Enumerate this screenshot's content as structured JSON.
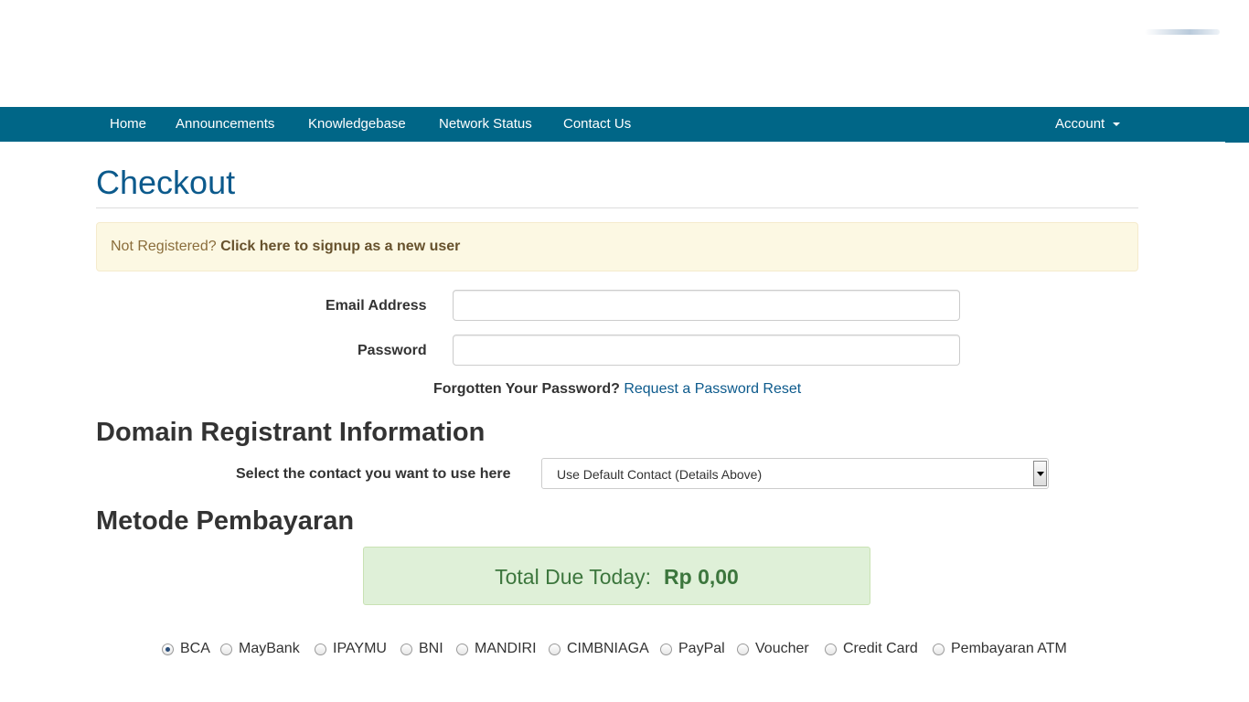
{
  "colors": {
    "navbar": "#006687",
    "title": "#0c5a8c",
    "alert_bg": "#fcf8e3",
    "total_bg": "#dff0d8",
    "total_text": "#3c763d"
  },
  "nav": {
    "items": [
      {
        "label": "Home"
      },
      {
        "label": "Announcements"
      },
      {
        "label": "Knowledgebase"
      },
      {
        "label": "Network Status"
      },
      {
        "label": "Contact Us"
      }
    ],
    "account_label": "Account",
    "account_icon": "caret-down-icon"
  },
  "page": {
    "title": "Checkout"
  },
  "alert": {
    "prefix": "Not Registered?",
    "link": "Click here to signup as a new user"
  },
  "login": {
    "email_label": "Email Address",
    "email_value": "",
    "password_label": "Password",
    "password_value": "",
    "forgot_text": "Forgotten Your Password?",
    "forgot_link": "Request a Password Reset"
  },
  "registrant": {
    "heading": "Domain Registrant Information",
    "contact_label": "Select the contact you want to use here",
    "contact_selected": "Use Default Contact (Details Above)"
  },
  "payment": {
    "heading": "Metode Pembayaran",
    "total_label": "Total Due Today:",
    "total_amount": "Rp 0,00",
    "selected": "BCA",
    "methods": [
      {
        "label": "BCA",
        "checked": true
      },
      {
        "label": "MayBank",
        "checked": false
      },
      {
        "label": "IPAYMU",
        "checked": false
      },
      {
        "label": "BNI",
        "checked": false
      },
      {
        "label": "MANDIRI",
        "checked": false
      },
      {
        "label": "CIMBNIAGA",
        "checked": false
      },
      {
        "label": "PayPal",
        "checked": false
      },
      {
        "label": "Voucher",
        "checked": false
      },
      {
        "label": "Credit Card",
        "checked": false
      },
      {
        "label": "Pembayaran ATM",
        "checked": false
      }
    ]
  }
}
